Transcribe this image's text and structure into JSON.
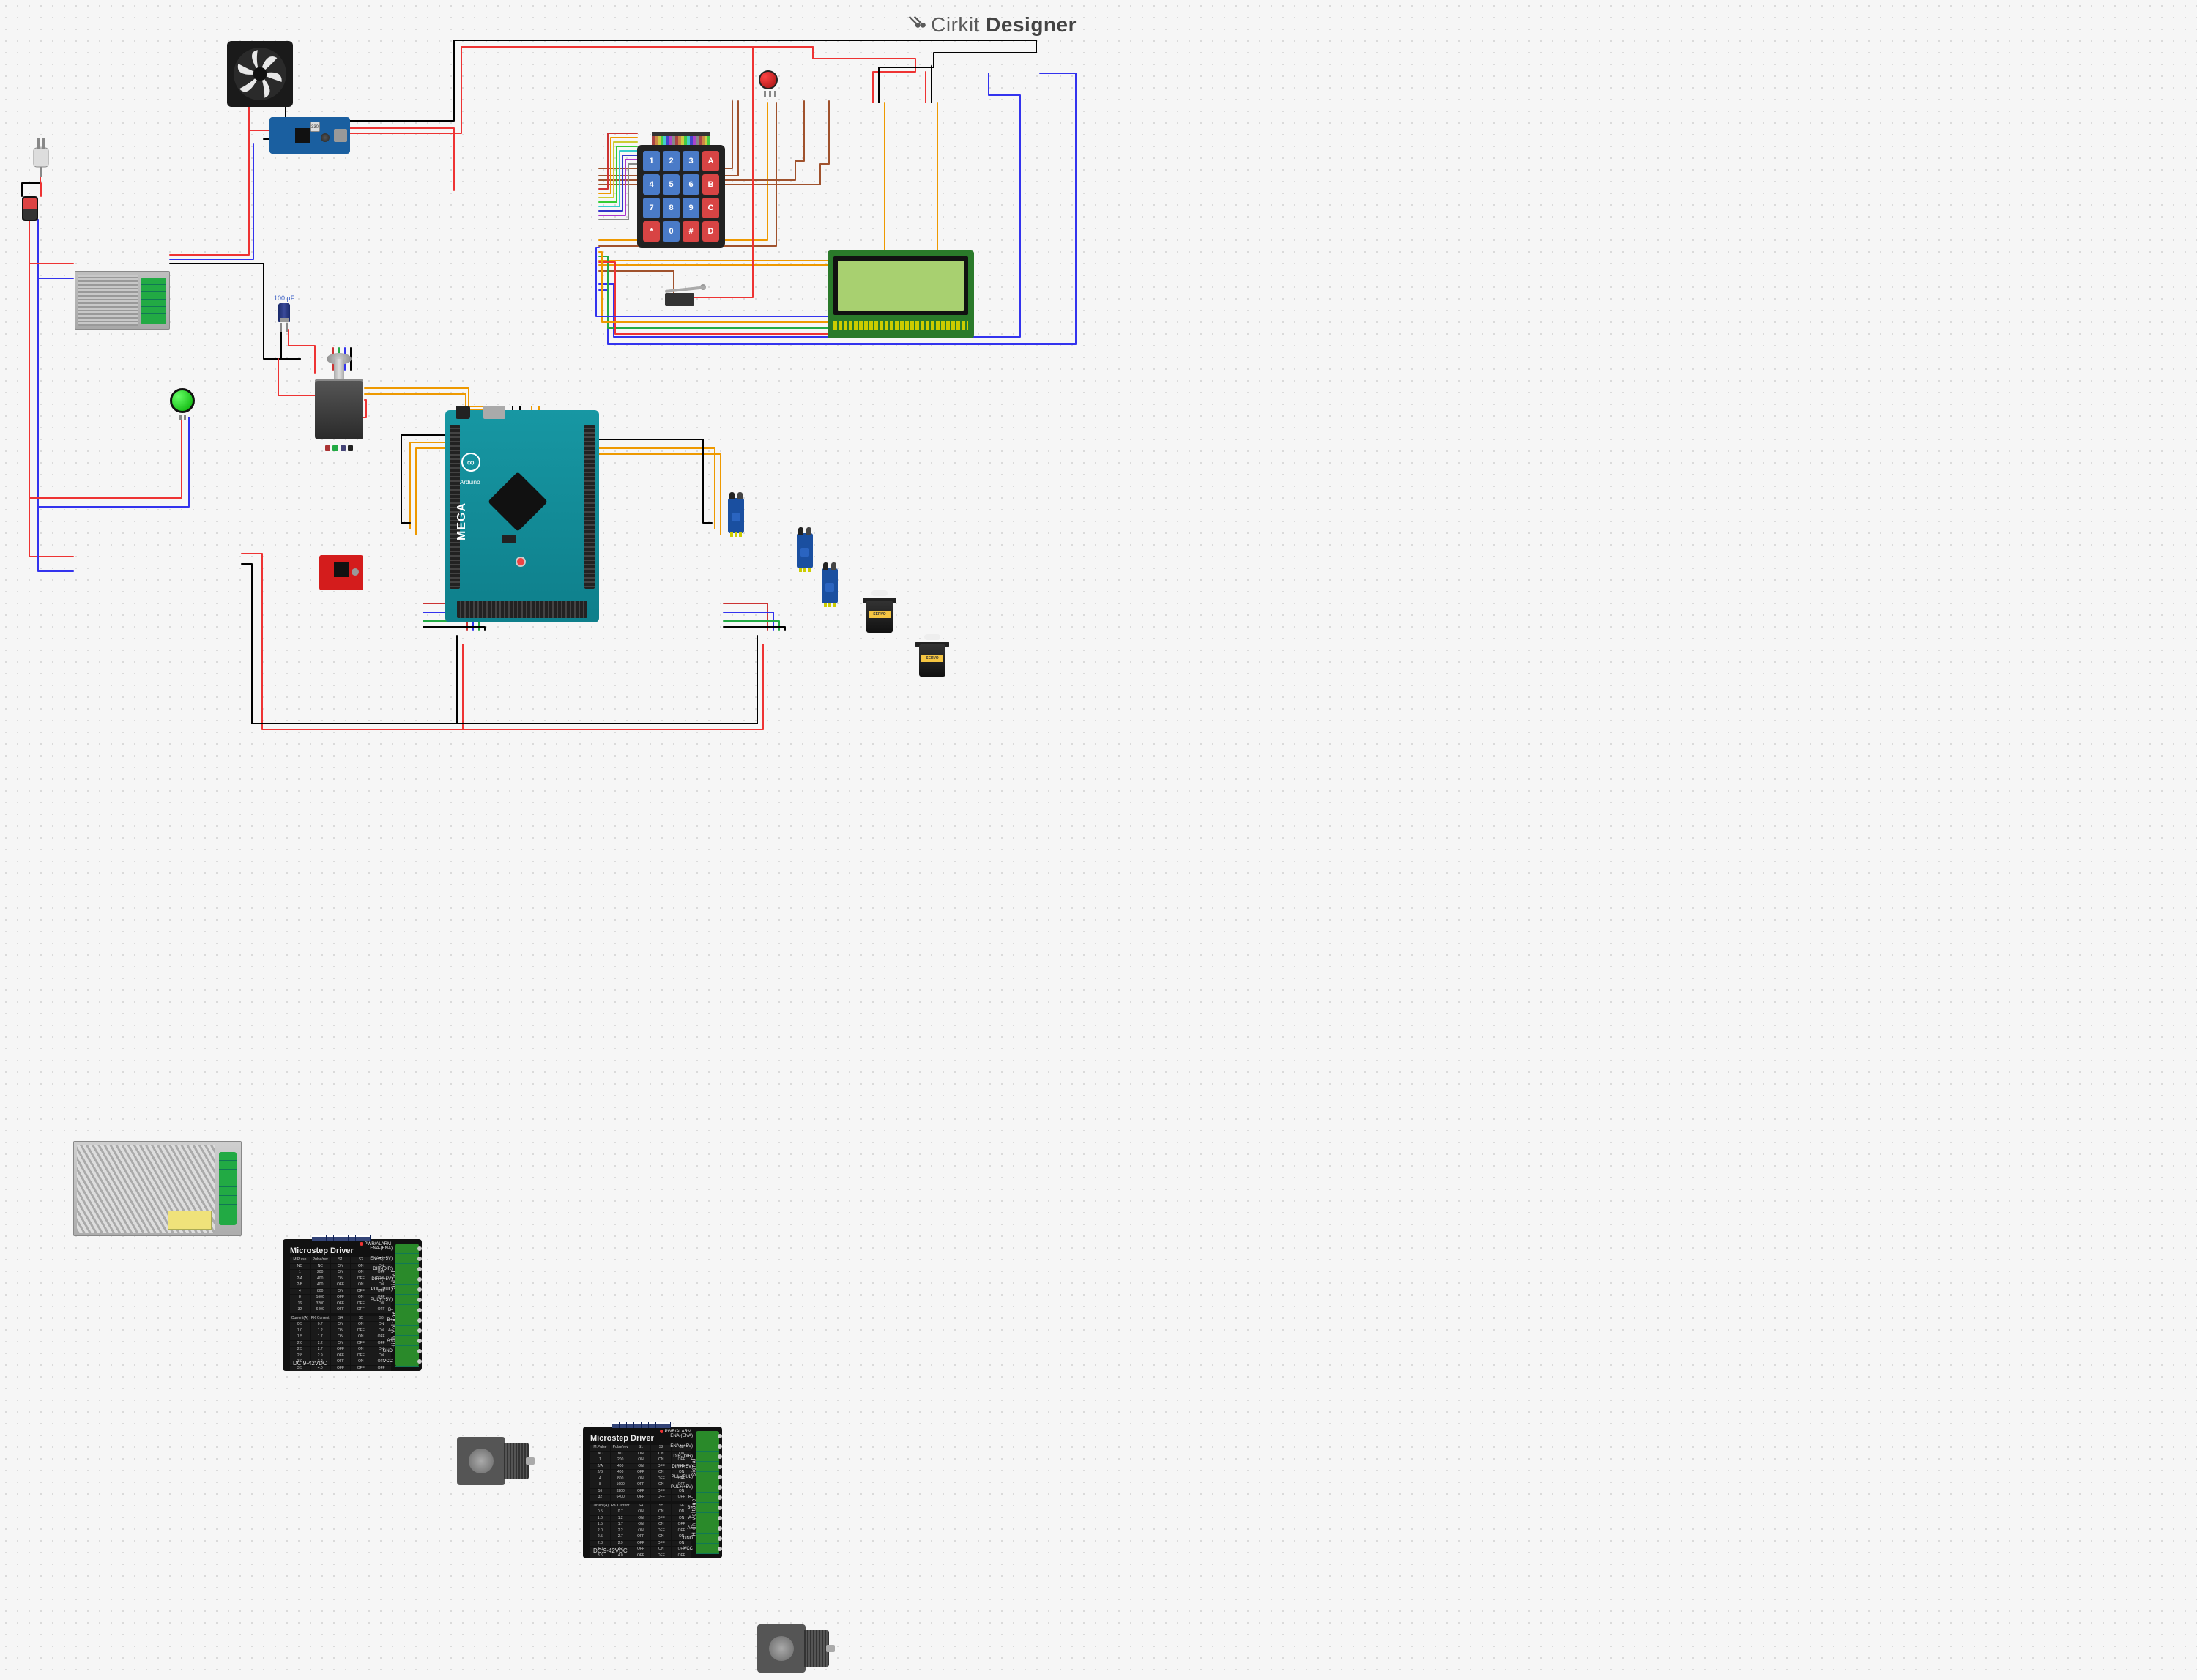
{
  "brand": {
    "name_light": "Cirkit",
    "name_bold": " Designer"
  },
  "components": {
    "fan": {
      "name": "DC cooling fan"
    },
    "buck": {
      "name": "Buck converter / USB power module",
      "cap_marking": "330"
    },
    "plug": {
      "name": "AC mains plug"
    },
    "rocker": {
      "name": "rocker switch"
    },
    "psu_small": {
      "name": "Power supply 12V (small)"
    },
    "psu_large": {
      "name": "Switching power supply (large)"
    },
    "capacitor": {
      "label": "100 µF",
      "name": "Electrolytic capacitor"
    },
    "nema_single": {
      "name": "NEMA stepper motor"
    },
    "mega": {
      "brand": "Arduino",
      "model": "MEGA",
      "name": "Arduino Mega 2560"
    },
    "a4988": {
      "name": "A4988 stepper driver"
    },
    "pilot": {
      "name": "Green pilot lamp / pushbutton"
    },
    "keypad": {
      "name": "4x4 matrix keypad",
      "keys": [
        "1",
        "2",
        "3",
        "A",
        "4",
        "5",
        "6",
        "B",
        "7",
        "8",
        "9",
        "C",
        "*",
        "0",
        "#",
        "D"
      ]
    },
    "ir1": {
      "name": "IR obstacle sensor"
    },
    "ir2": {
      "name": "IR obstacle sensor"
    },
    "ir3": {
      "name": "IR obstacle sensor"
    },
    "button": {
      "name": "Red pushbutton"
    },
    "servo1": {
      "label": "SERVO",
      "name": "Servo motor"
    },
    "servo2": {
      "label": "SERVO",
      "name": "Servo motor"
    },
    "microswitch": {
      "name": "Micro / limit switch"
    },
    "lcd": {
      "name": "20x4 character LCD"
    },
    "driver1": {
      "title": "Microstep Driver",
      "range": "DC:9-42VDC",
      "pwr_label": "PWR/ALARM",
      "signal_label": "Signal",
      "hv_label": "High Voltage",
      "terminals": [
        "ENA-(ENA)",
        "ENA+(+5V)",
        "DIR-(DIR)",
        "DIR+(+5V)",
        "PUL-(PUL)",
        "PUL+(+5V)",
        "B-",
        "B+",
        "A-",
        "A+",
        "GND",
        "VCC"
      ],
      "table_head": [
        "M.Pulse",
        "Pulse/rev",
        "S1",
        "S2",
        "S3"
      ],
      "table_rows": [
        [
          "NC",
          "NC",
          "ON",
          "ON",
          "ON"
        ],
        [
          "1",
          "200",
          "ON",
          "ON",
          "OFF"
        ],
        [
          "2/A",
          "400",
          "ON",
          "OFF",
          "ON"
        ],
        [
          "2/B",
          "400",
          "OFF",
          "ON",
          "ON"
        ],
        [
          "4",
          "800",
          "ON",
          "OFF",
          "OFF"
        ],
        [
          "8",
          "1600",
          "OFF",
          "ON",
          "OFF"
        ],
        [
          "16",
          "3200",
          "OFF",
          "OFF",
          "ON"
        ],
        [
          "32",
          "6400",
          "OFF",
          "OFF",
          "OFF"
        ]
      ],
      "cur_head": [
        "Current(A)",
        "PK Current",
        "S4",
        "S5",
        "S6"
      ],
      "cur_rows": [
        [
          "0.5",
          "0.7",
          "ON",
          "ON",
          "ON"
        ],
        [
          "1.0",
          "1.2",
          "ON",
          "OFF",
          "ON"
        ],
        [
          "1.5",
          "1.7",
          "ON",
          "ON",
          "OFF"
        ],
        [
          "2.0",
          "2.2",
          "ON",
          "OFF",
          "OFF"
        ],
        [
          "2.5",
          "2.7",
          "OFF",
          "ON",
          "ON"
        ],
        [
          "2.8",
          "2.9",
          "OFF",
          "OFF",
          "ON"
        ],
        [
          "3.0",
          "3.2",
          "OFF",
          "ON",
          "OFF"
        ],
        [
          "3.5",
          "4.0",
          "OFF",
          "OFF",
          "OFF"
        ]
      ]
    },
    "driver2": {
      "same_as": "driver1"
    },
    "stepper1": {
      "name": "NEMA17 stepper motor"
    },
    "stepper2": {
      "name": "NEMA17 stepper motor"
    }
  }
}
